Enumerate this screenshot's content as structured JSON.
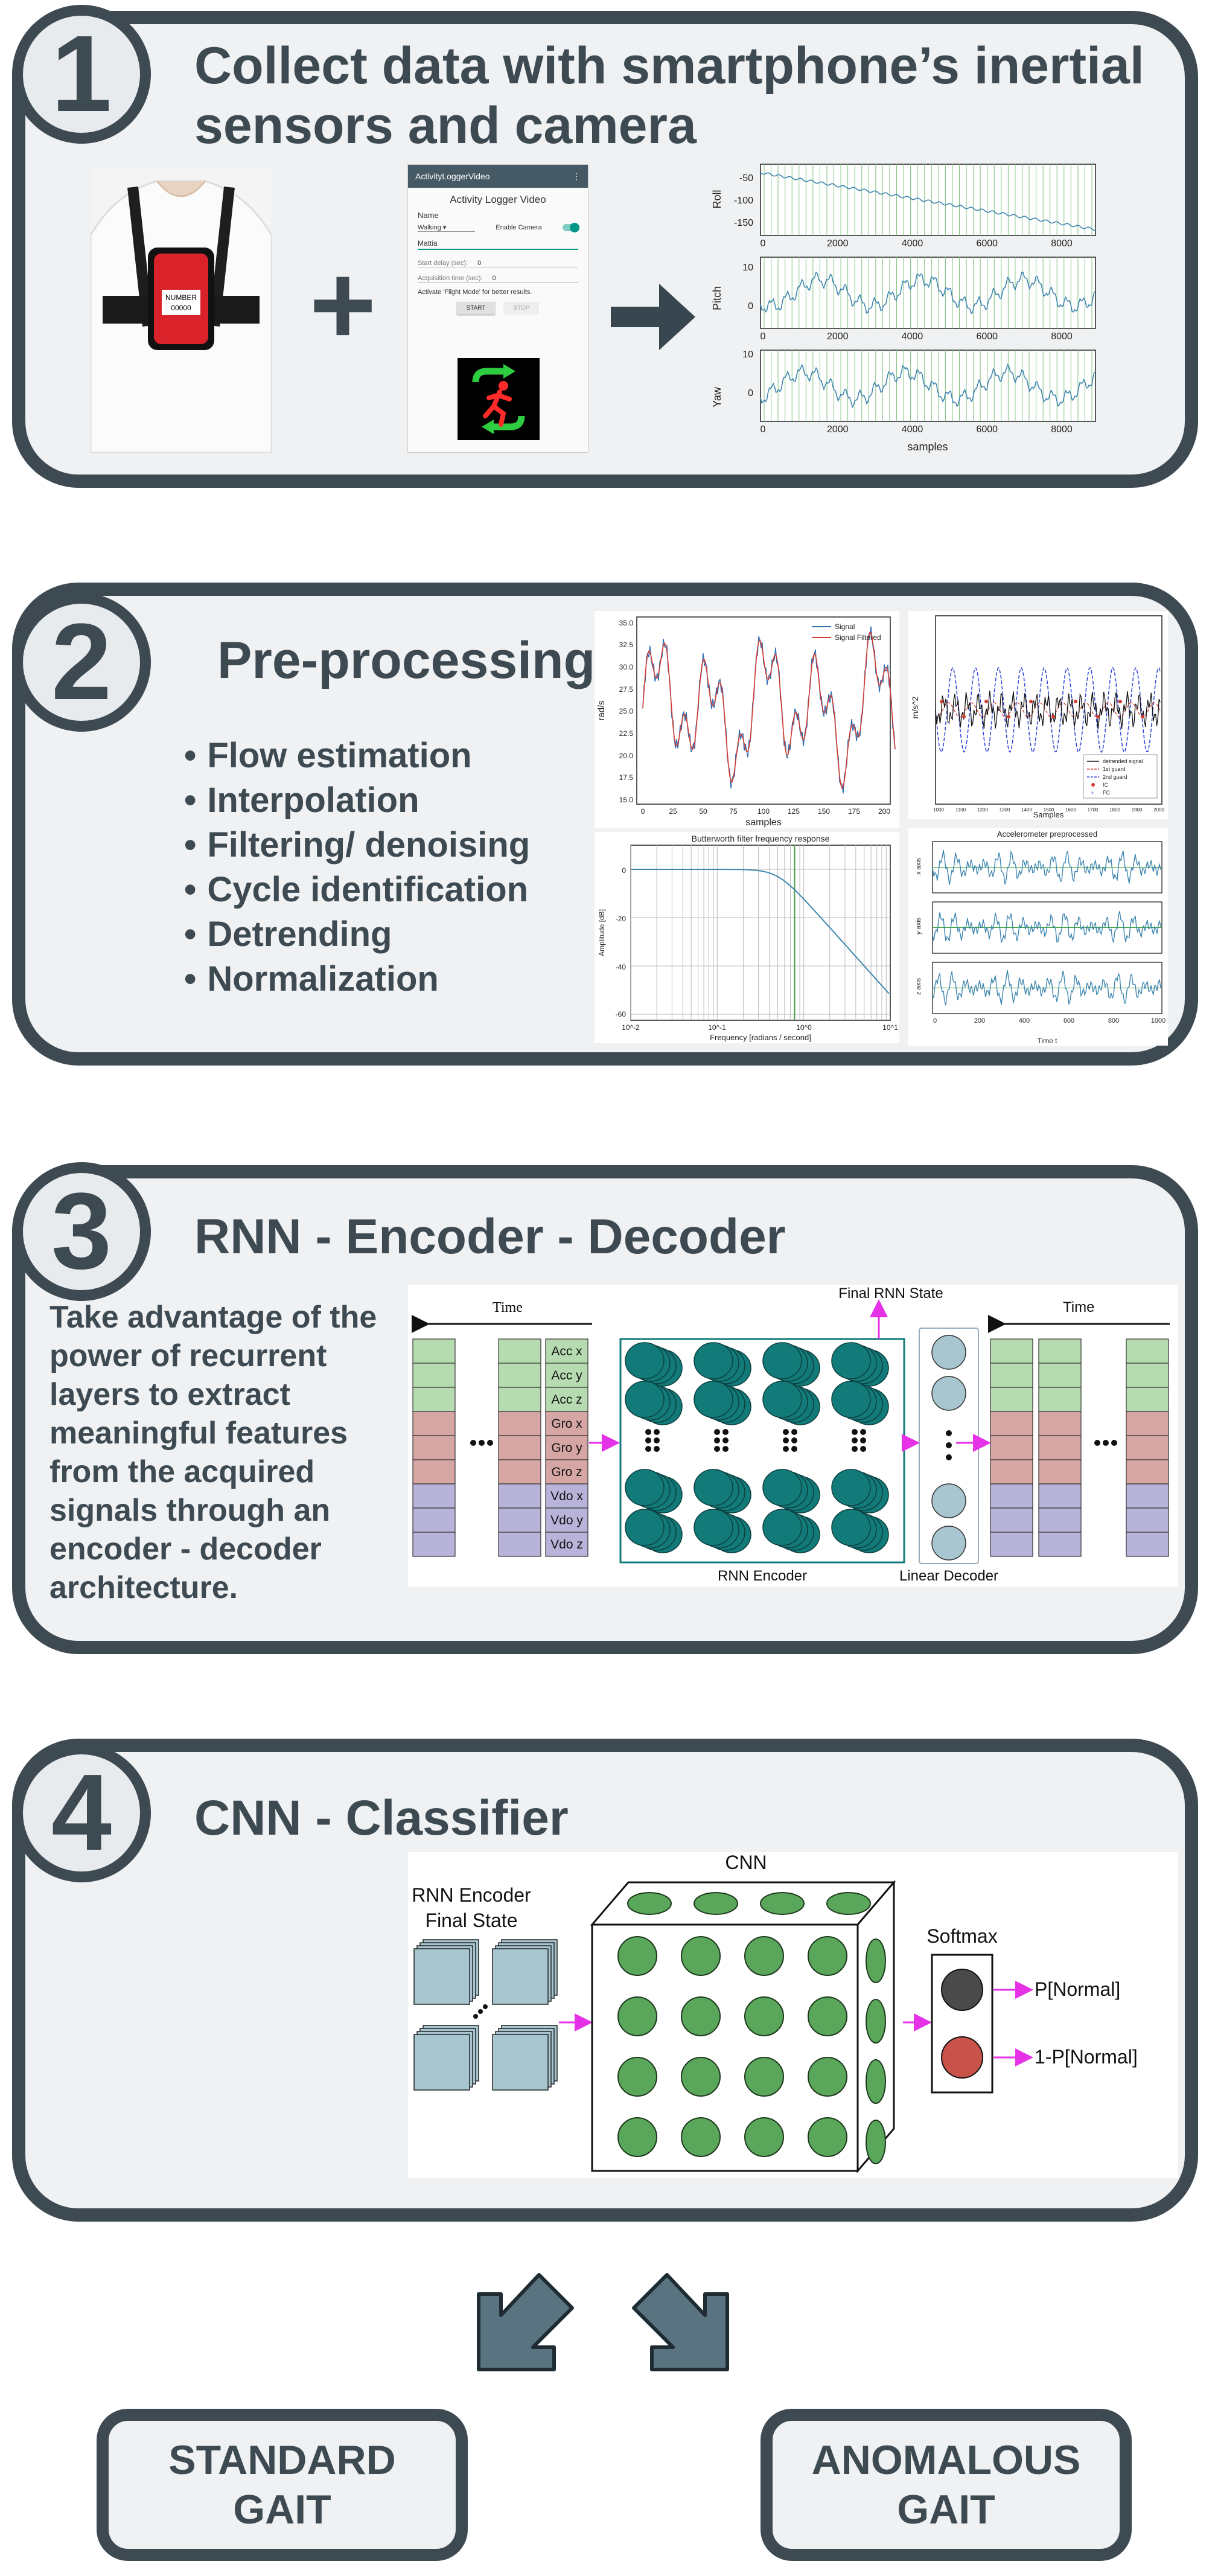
{
  "step1": {
    "number": "1",
    "title_line1": "Collect data with smartphone’s inertial",
    "title_line2": "sensors and camera",
    "phone_sticker_line1": "NUMBER",
    "phone_sticker_line2": "00000",
    "app": {
      "header": "ActivityLoggerVideo",
      "title": "Activity Logger Video",
      "name_label": "Name",
      "activity_value": "Walking",
      "camera_label": "Enable Camera",
      "name_value": "Mattia",
      "start_delay_label": "Start delay (sec):",
      "start_delay_value": "0",
      "acq_time_label": "Acquisition time (sec):",
      "acq_time_value": "0",
      "hint": "Activate 'Flight Mode' for better results.",
      "start_button": "START",
      "stop_button": "STOP"
    },
    "plus": "+",
    "plots": {
      "panels": [
        {
          "ylabel": "Roll",
          "yticks": [
            "-50",
            "-100",
            "-150"
          ]
        },
        {
          "ylabel": "Pitch",
          "yticks": [
            "10",
            "0"
          ]
        },
        {
          "ylabel": "Yaw",
          "yticks": [
            "10",
            "0"
          ]
        }
      ],
      "xticks": [
        "0",
        "2000",
        "4000",
        "6000",
        "8000"
      ],
      "xlabel": "samples"
    }
  },
  "step2": {
    "number": "2",
    "title": "Pre-processing",
    "bullets": [
      "Flow estimation",
      "Interpolation",
      "Filtering/ denoising",
      "Cycle identification",
      "Detrending",
      "Normalization"
    ],
    "chart_a": {
      "ylabel": "rad/s",
      "xlabel": "samples",
      "yticks": [
        "35.0",
        "32.5",
        "30.0",
        "27.5",
        "25.0",
        "22.5",
        "20.0",
        "17.5",
        "15.0"
      ],
      "xticks": [
        "0",
        "25",
        "50",
        "75",
        "100",
        "125",
        "150",
        "175",
        "200"
      ],
      "legend": [
        "Signal",
        "Signal Filtered"
      ]
    },
    "chart_b": {
      "ylabel": "m/s^2",
      "xlabel": "Samples",
      "xticks": [
        "1000",
        "1100",
        "1200",
        "1300",
        "1400",
        "1500",
        "1600",
        "1700",
        "1800",
        "1900",
        "2000"
      ],
      "legend": [
        "detrended signal",
        "1st guard",
        "2nd guard",
        "IC",
        "FC"
      ]
    },
    "chart_c": {
      "title": "Butterworth filter frequency response",
      "ylabel": "Amplitude [dB]",
      "xlabel": "Frequency [radians / second]",
      "yticks": [
        "0",
        "-20",
        "-40",
        "-60"
      ],
      "xticks": [
        "10^-2",
        "10^-1",
        "10^0",
        "10^1"
      ]
    },
    "chart_d": {
      "title": "Accelerometer preprocessed",
      "ylabels": [
        "x axis",
        "y axis",
        "z axis"
      ],
      "xticks": [
        "0",
        "200",
        "400",
        "600",
        "800",
        "1000"
      ],
      "xlabel": "Time t"
    }
  },
  "step3": {
    "number": "3",
    "title": "RNN - Encoder - Decoder",
    "description": "Take advantage of the power of recurrent layers to extract meaningful features from the acquired signals through an encoder - decoder architecture.",
    "time_left": "Time",
    "time_right": "Time",
    "final_state": "Final RNN State",
    "channels": [
      "Acc x",
      "Acc y",
      "Acc z",
      "Gro x",
      "Gro y",
      "Gro z",
      "Vdo x",
      "Vdo y",
      "Vdo z"
    ],
    "encoder_label": "RNN Encoder",
    "decoder_label": "Linear Decoder"
  },
  "step4": {
    "number": "4",
    "title": "CNN - Classifier",
    "encoder_label_line1": "RNN Encoder",
    "encoder_label_line2": "Final  State",
    "cnn_label": "CNN",
    "softmax_label": "Softmax",
    "p_normal": "P[Normal]",
    "p_not_normal": "1-P[Normal]"
  },
  "outcomes": {
    "standard_line1": "STANDARD",
    "standard_line2": "GAIT",
    "anomalous_line1": "ANOMALOUS",
    "anomalous_line2": "GAIT"
  },
  "colors": {
    "panel_border": "#3e4a52",
    "panel_fill": "#eff1f3",
    "teal": "#127a78",
    "green_rows": "#b7dbb1",
    "red_rows": "#d6a6a5",
    "purple_rows": "#b7b3d9",
    "arrow_magenta": "#e632e6",
    "cnn_green": "#5aa65a",
    "decoder_blue": "#a7c6d0",
    "signal_blue": "#2c6fb5",
    "signal_red": "#d23b32"
  }
}
